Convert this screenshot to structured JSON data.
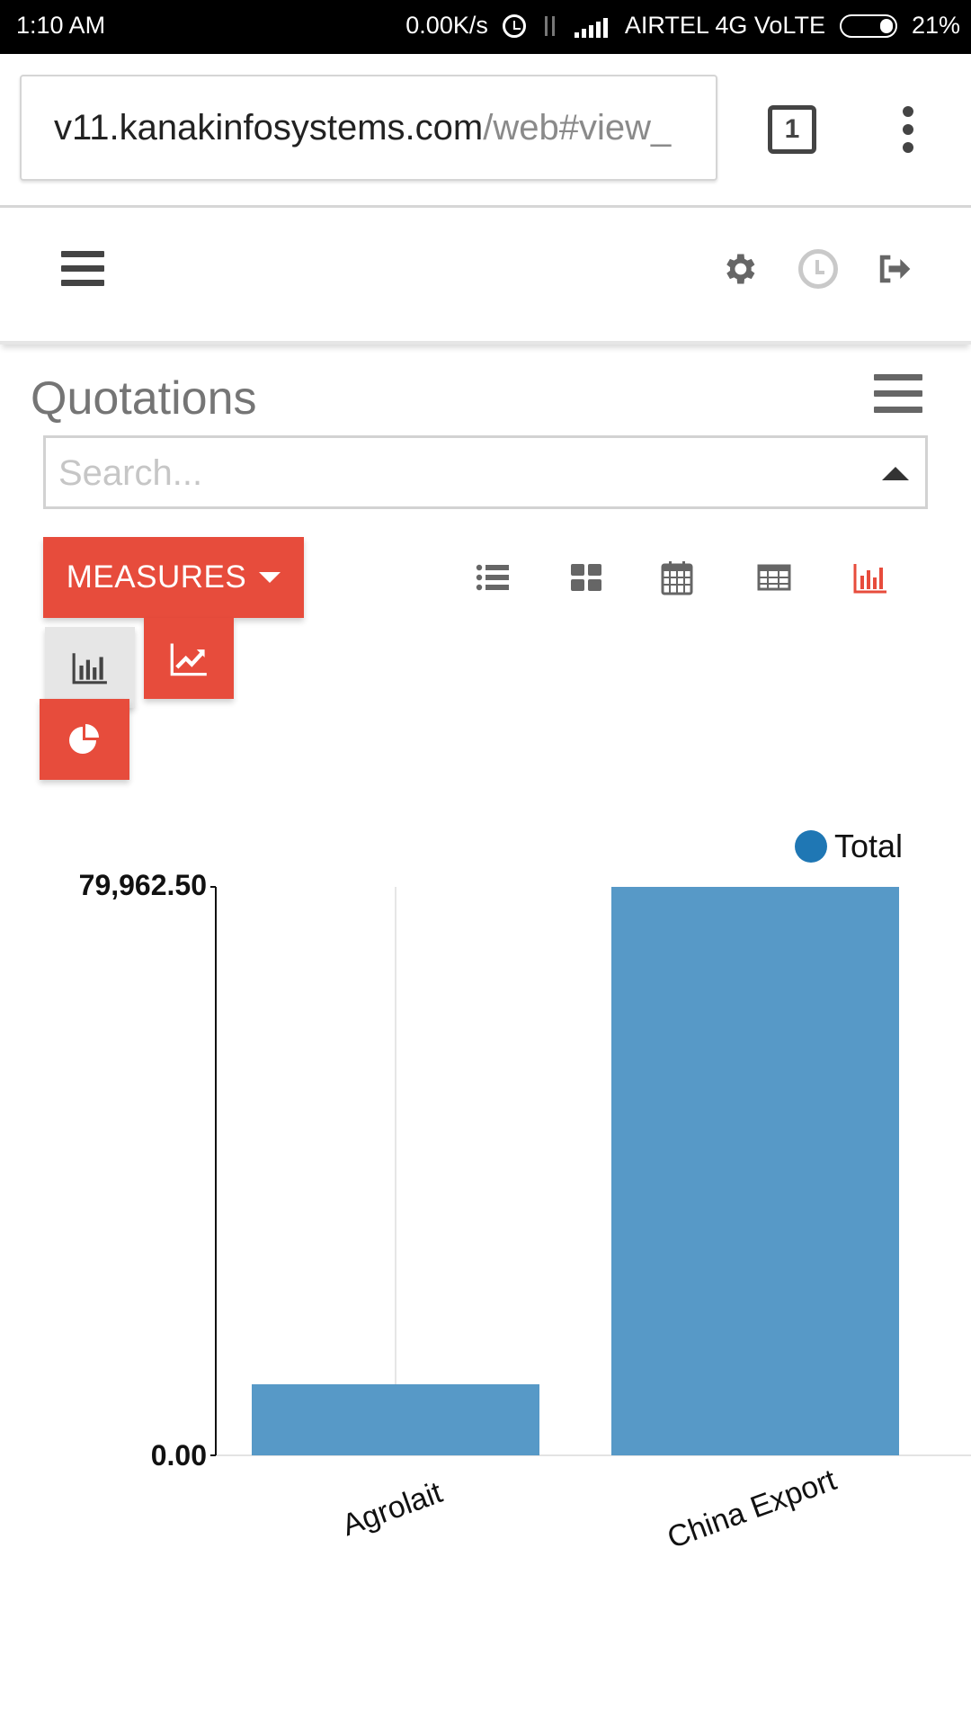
{
  "status_bar": {
    "time": "1:10 AM",
    "network_speed": "0.00K/s",
    "carrier": "AIRTEL 4G VoLTE",
    "battery": "21%",
    "icons": [
      "alarm-icon",
      "data-transfer-icon",
      "signal-icon",
      "battery-icon"
    ]
  },
  "browser": {
    "url_host": "v11.kanakinfosystems.com",
    "url_path": "/web#view_",
    "tab_count": "1",
    "icons": [
      "tabs-icon",
      "kebab-menu-icon"
    ]
  },
  "navbar": {
    "icons": [
      "hamburger-icon",
      "gear-icon",
      "clock-icon",
      "logout-icon"
    ]
  },
  "page": {
    "title": "Quotations",
    "search_placeholder": "Search...",
    "measures_label": "MEASURES",
    "view_switcher": [
      "list-icon",
      "kanban-icon",
      "calendar-icon",
      "pivot-icon",
      "graph-icon"
    ],
    "active_view": "graph",
    "chart_modes": [
      "bar-chart-icon",
      "line-chart-icon",
      "pie-chart-icon"
    ],
    "active_mode": "bar",
    "accent_color": "#e74c3c"
  },
  "chart_data": {
    "type": "bar",
    "categories": [
      "Agrolait",
      "China Export"
    ],
    "series": [
      {
        "name": "Total",
        "values": [
          10000,
          79962.5
        ],
        "color": "#5799c7"
      }
    ],
    "yticks": [
      "79,962.50",
      "0.00"
    ],
    "ylim": [
      0,
      79962.5
    ],
    "legend": "top-right",
    "grid": false
  }
}
